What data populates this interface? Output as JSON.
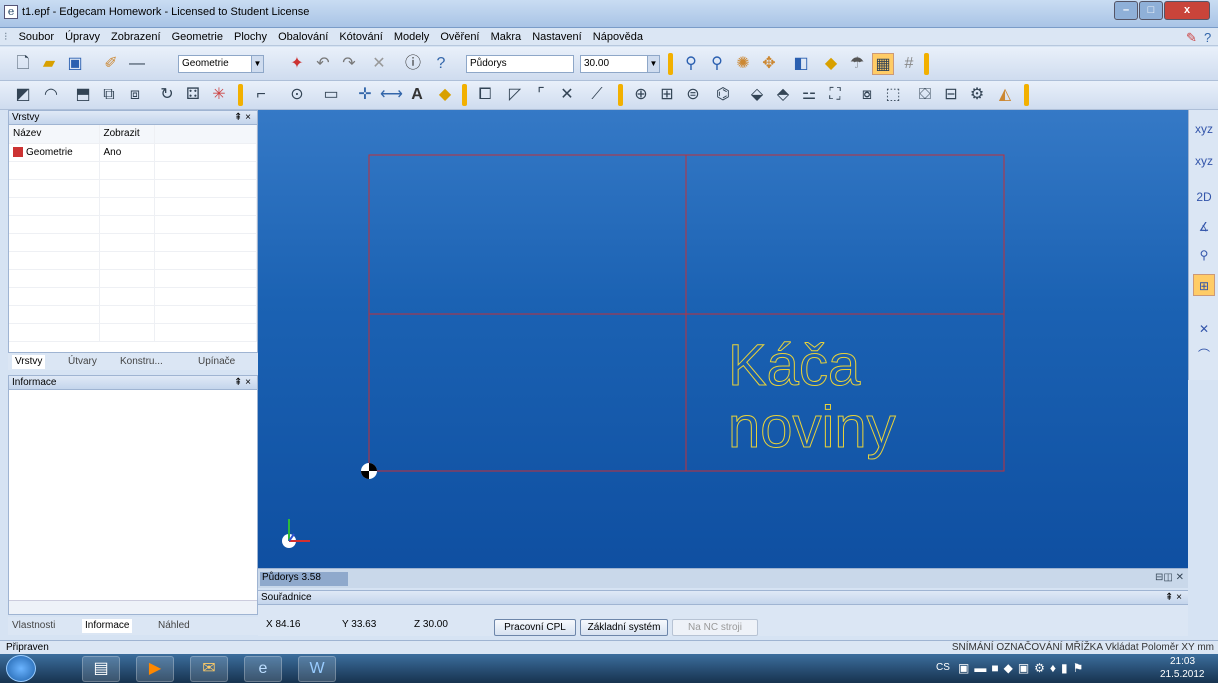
{
  "window": {
    "title": "t1.epf - Edgecam Homework - Licensed to Student License",
    "app_icon": "e",
    "minimize": "–",
    "maximize": "□",
    "close": "x"
  },
  "menu": [
    "Soubor",
    "Úpravy",
    "Zobrazení",
    "Geometrie",
    "Plochy",
    "Obalování",
    "Kótování",
    "Modely",
    "Ověření",
    "Makra",
    "Nastavení",
    "Nápověda"
  ],
  "toolbar1": {
    "layer_combo": "Geometrie",
    "view_combo": "Půdorys",
    "depth_combo": "30.00"
  },
  "layers_panel": {
    "title": "Vrstvy",
    "pin": "⇞ ×",
    "col_name": "Název",
    "col_show": "Zobrazit",
    "rows": [
      {
        "name": "Geometrie",
        "show": "Ano"
      }
    ],
    "tabs": [
      "Vrstvy",
      "Útvary",
      "Konstru...",
      "Upínače"
    ]
  },
  "info_panel": {
    "title": "Informace",
    "pin": "⇞ ×",
    "tabs": [
      "Vlastnosti",
      "Informace",
      "Náhled"
    ]
  },
  "viewport": {
    "text_line1": "Káča",
    "text_line2": "noviny",
    "status": "Půdorys 3.58",
    "status_right": "⊟◫ ✕"
  },
  "coords_panel": {
    "title": "Souřadnice",
    "pin": "⇞ ×",
    "x": "X 84.16",
    "y": "Y 33.63",
    "z": "Z 30.00",
    "btn_cpl": "Pracovní CPL",
    "btn_base": "Základní systém",
    "btn_nc": "Na NC stroji"
  },
  "statusbar": {
    "left": "Připraven",
    "right": "SNÍMÁNÍ  OZNAČOVÁNÍ  MŘÍŽKA  Vkládat  Poloměr  XY  mm"
  },
  "taskbar": {
    "lang": "CS",
    "time": "21:03",
    "date": "21.5.2012"
  },
  "colors": {
    "viewport_top": "#3579c6",
    "viewport_bottom": "#0e4ea0",
    "geometry_lines": "#c0303a",
    "text_outline": "#e8d23a"
  }
}
